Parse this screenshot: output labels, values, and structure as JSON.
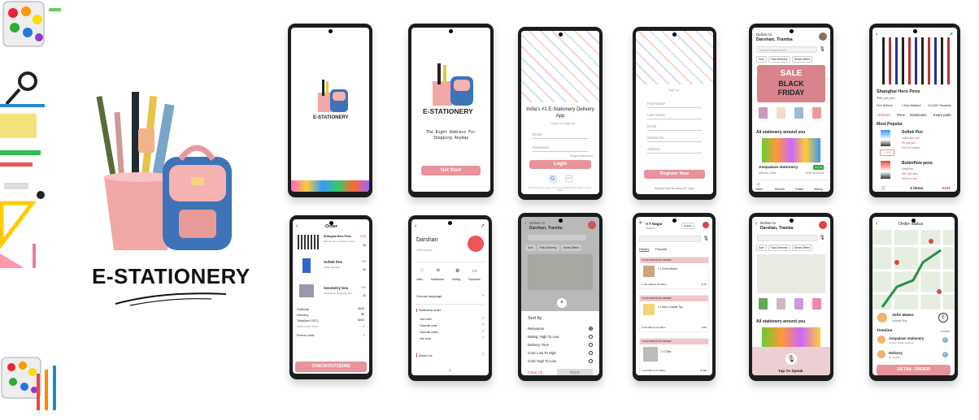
{
  "brand": {
    "title": "E-STATIONERY"
  },
  "s1": {
    "title": "E-STATIONERY"
  },
  "s2": {
    "title": "E-STATIONERY",
    "tagline": "The Right Address For Shopping Anyday",
    "cta": "Get Start"
  },
  "s3": {
    "headline": "India's #1 E-Stationery Delivery App",
    "sub": "Log in or Sign up",
    "email": "Email",
    "password": "Password",
    "forgot": "Forgot Password?",
    "login": "Login",
    "terms": "By continuing you agree to Terms of service Privacy Policy Content Policy"
  },
  "s4": {
    "sub": "Sign up",
    "fields": [
      "First Name",
      "Last Name",
      "Email",
      "Mobile No.",
      "Address"
    ],
    "register": "Register Now",
    "have_account": "Already Have an account? Login"
  },
  "s5": {
    "deliver_to": "Deliver to",
    "location": "Darshan, Tramba",
    "search": "Search items here...",
    "chips": [
      "Sort",
      "Fast Delivery",
      "Great Offers"
    ],
    "sale1": "SALE",
    "sale2": "BLACK",
    "sale3": "FRIDAY",
    "section": "All stationery around you",
    "shop": "Asopalave stationery",
    "shop_loc": "Mahuva, India",
    "shop_price": "₹150 for all set",
    "rating": "4.2 ★",
    "nav": [
      "Home",
      "Reorder",
      "Orders",
      "History"
    ]
  },
  "s6": {
    "product": "Shanghai Hero Pens",
    "price": "₹50, per pen",
    "stats": [
      "Free Delivery",
      "1.5 km Distance",
      "4.5 (100+ Reviews)"
    ],
    "tabs": [
      "All Items",
      "Pens",
      "Notebooks",
      "Exam pads"
    ],
    "section": "Most Popular",
    "items": [
      {
        "name": "Softek Pen",
        "desc": "softek blue pen",
        "price": "₹1, per pen",
        "sub": "₹10 for 4 piece"
      },
      {
        "name": "Butterflow pens",
        "desc": "butterflow",
        "price": "₹30, per item",
        "sub": "₹50 for 4 set"
      }
    ],
    "add": "+ ADD",
    "count": "3 items",
    "total": "$340"
  },
  "s7": {
    "title": "Order",
    "items": [
      {
        "name": "Shanghai Hero Pens",
        "desc": "with all tools of class & more",
        "price": "₹340",
        "qty": "$1"
      },
      {
        "name": "Softek Pen",
        "desc": "softek blue pen",
        "price": "₹20",
        "qty": "$1"
      },
      {
        "name": "Geometry box",
        "desc": "Camelinuts Geometry box",
        "price": "₹30",
        "qty": "$1"
      }
    ],
    "summary": [
      {
        "k": "Subtotal",
        "v": "$340"
      },
      {
        "k": "Delivery",
        "v": "$0"
      },
      {
        "k": "Total(Incl GST)",
        "v": "$340"
      }
    ],
    "add_more": "Add more item",
    "promo": "Promo code",
    "checkout": "CHECKOUT($340)"
  },
  "s8": {
    "name": "Darshan",
    "link": "View activity",
    "icons": [
      "Likes",
      "Notification",
      "Setting",
      "Payments"
    ],
    "lang": "Choose language",
    "section": "Stationery order",
    "orders": [
      "Your order",
      "Favourite order",
      "Favourite orders",
      "Like order"
    ],
    "about": "About Us"
  },
  "s9": {
    "deliver_to": "Deliver to",
    "location": "Darshan, Tramba",
    "chips": [
      "Sort",
      "Fast Delivery",
      "Great Offers"
    ],
    "sort_title": "Sort by",
    "options": [
      "Relevance",
      "Rating: High To Low",
      "Delivery Time",
      "Cost: Low To High",
      "Cost: High To Low"
    ],
    "clear": "Clear All",
    "apply": "Apply"
  },
  "s10": {
    "addr": "V.T Nagar",
    "city": "Mahuva",
    "lang": "English",
    "tabs": [
      "History",
      "Favorite"
    ],
    "orders": [
      {
        "head": "YOUR PREVIOUS ORDER",
        "item": "1 x Chess Board",
        "date": "1 Jun 2022 at 10:30am",
        "price": "$ 70"
      },
      {
        "head": "YOUR PREVIOUS ORDER",
        "item": "1 x Soft n Cuddle Toy",
        "date": "9 Jul 2022 at 12:30pm",
        "price": "$ 50"
      },
      {
        "head": "YOUR PREVIOUS ORDER",
        "item": "1 X Tiles",
        "date": "4 Jul 2022 at 11:30am",
        "price": "$ 360"
      }
    ]
  },
  "s11": {
    "deliver_to": "Deliver to",
    "location": "Darshan, Tramba",
    "chips": [
      "Sort",
      "Fast Delivery",
      "Great Offers"
    ],
    "section": "All stationery around you",
    "speak": "Tap To Speak"
  },
  "s12": {
    "title": "Order status",
    "agent": "John Maten",
    "agent_role": "Delivery Boy",
    "timeline": "Timeline",
    "arrival": "in transit",
    "steps": [
      {
        "name": "Asopalave stationery",
        "sub": "Garden Road, mahuva"
      },
      {
        "name": "Delivery",
        "sub": "30 minutes"
      }
    ],
    "cta": "DETAIL ORDER"
  },
  "colors": {
    "pink": "#e8939b",
    "dark": "#1c1c1c",
    "banner": "#d9848c"
  }
}
